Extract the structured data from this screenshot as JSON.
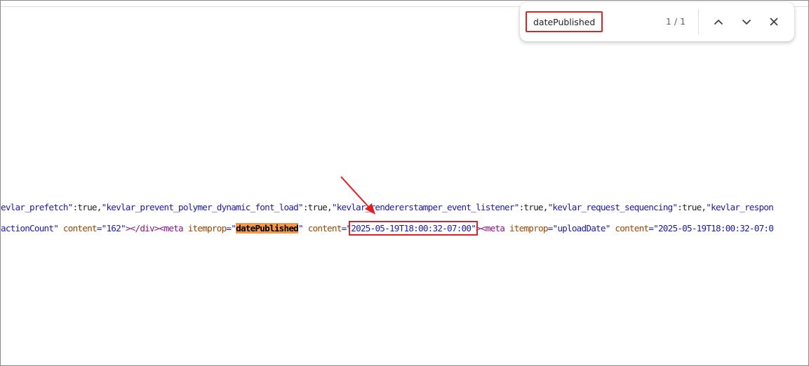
{
  "find_bar": {
    "query": "datePublished",
    "match_count": "1 / 1",
    "prev_icon": "chevron-up-icon",
    "next_icon": "chevron-down-icon",
    "close_icon": "close-icon"
  },
  "source": {
    "line1": [
      {
        "text": "evlar_prefetch\"",
        "cls": "c-str"
      },
      {
        "text": ":true,",
        "cls": "c-plain"
      },
      {
        "text": "\"kevlar_prevent_polymer_dynamic_font_load\"",
        "cls": "c-str"
      },
      {
        "text": ":true,",
        "cls": "c-plain"
      },
      {
        "text": "\"kevlar_rendererstamper_event_listener\"",
        "cls": "c-str"
      },
      {
        "text": ":true,",
        "cls": "c-plain"
      },
      {
        "text": "\"kevlar_request_sequencing\"",
        "cls": "c-str"
      },
      {
        "text": ":true,",
        "cls": "c-plain"
      },
      {
        "text": "\"kevlar_respon",
        "cls": "c-str"
      }
    ],
    "line2": [
      {
        "text": "actionCount\"",
        "cls": "c-str"
      },
      {
        "text": " content",
        "cls": "c-attr"
      },
      {
        "text": "=\"162\"",
        "cls": "c-str"
      },
      {
        "text": "></div><meta",
        "cls": "c-tag"
      },
      {
        "text": " itemprop",
        "cls": "c-attr"
      },
      {
        "text": "=\"",
        "cls": "c-str"
      },
      {
        "text": "datePublished",
        "cls": "c-highlight"
      },
      {
        "text": "\"",
        "cls": "c-str"
      },
      {
        "text": " content",
        "cls": "c-attr"
      },
      {
        "text": "=\"",
        "cls": "c-str"
      },
      {
        "text": "2025-05-19T18:00:32-07:00\"",
        "cls": "c-str annot-box"
      },
      {
        "text": "><meta",
        "cls": "c-tag"
      },
      {
        "text": " itemprop",
        "cls": "c-attr"
      },
      {
        "text": "=\"uploadDate\"",
        "cls": "c-str"
      },
      {
        "text": " content",
        "cls": "c-attr"
      },
      {
        "text": "=\"2025-05-19T18:00:32-07:0",
        "cls": "c-str"
      }
    ]
  },
  "colors": {
    "annotation": "#d9252a",
    "highlight": "#f2984a",
    "string": "#1a1aa6",
    "attribute": "#994500",
    "tag": "#881280"
  }
}
